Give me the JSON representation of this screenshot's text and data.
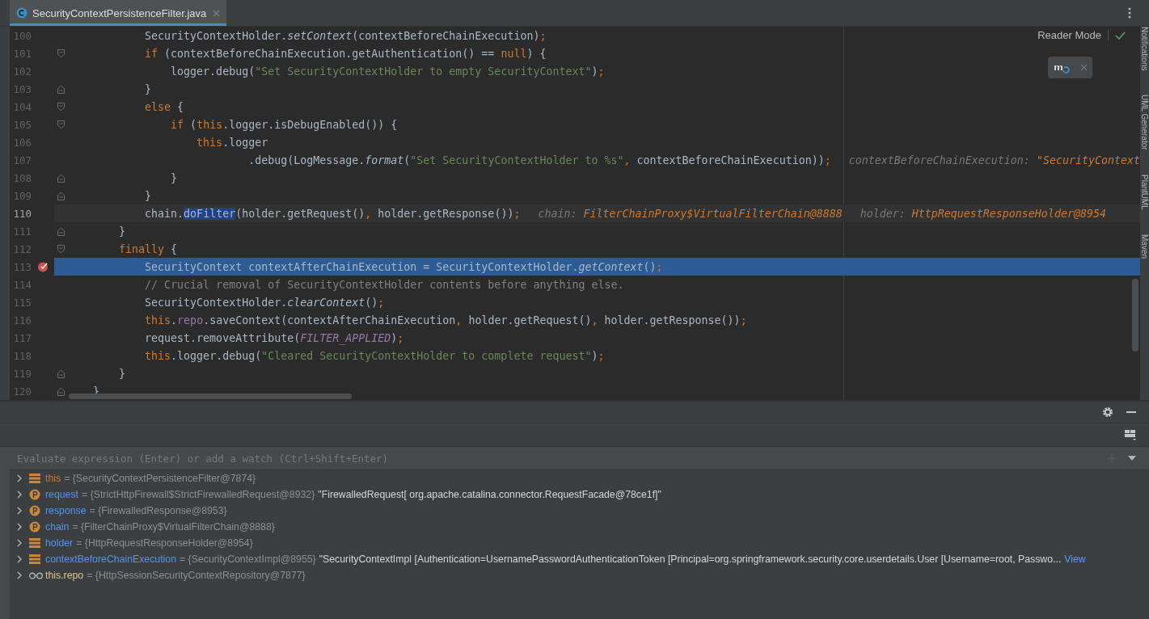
{
  "tab": {
    "title": "SecurityContextPersistenceFilter.java",
    "selected": true
  },
  "reader_mode": "Reader Mode",
  "lines": [
    {
      "number": "100",
      "current": false,
      "caret": false,
      "breakpoint": false,
      "fold_start": false,
      "fold_end": false,
      "code": [
        {
          "kind": "p",
          "t": "            SecurityContextHolder."
        },
        {
          "kind": "i",
          "t": "setContext"
        },
        {
          "kind": "p",
          "t": "(contextBeforeChainExecution)"
        },
        {
          "kind": "o",
          "t": ";"
        }
      ]
    },
    {
      "number": "101",
      "current": false,
      "caret": false,
      "breakpoint": false,
      "fold_start": true,
      "fold_end": false,
      "code": [
        {
          "kind": "o",
          "t": "            if "
        },
        {
          "kind": "p",
          "t": "(contextBeforeChainExecution.getAuthentication() == "
        },
        {
          "kind": "o",
          "t": "null"
        },
        {
          "kind": "p",
          "t": ") {"
        }
      ]
    },
    {
      "number": "102",
      "current": false,
      "caret": false,
      "breakpoint": false,
      "fold_start": false,
      "fold_end": false,
      "code": [
        {
          "kind": "p",
          "t": "                logger.debug("
        },
        {
          "kind": "s",
          "t": "\"Set SecurityContextHolder to empty SecurityContext\""
        },
        {
          "kind": "p",
          "t": ")"
        },
        {
          "kind": "o",
          "t": ";"
        }
      ]
    },
    {
      "number": "103",
      "current": false,
      "caret": false,
      "breakpoint": false,
      "fold_start": false,
      "fold_end": true,
      "code": [
        {
          "kind": "p",
          "t": "            }"
        }
      ]
    },
    {
      "number": "104",
      "current": false,
      "caret": false,
      "breakpoint": false,
      "fold_start": true,
      "fold_end": false,
      "code": [
        {
          "kind": "o",
          "t": "            else "
        },
        {
          "kind": "p",
          "t": "{"
        }
      ]
    },
    {
      "number": "105",
      "current": false,
      "caret": false,
      "breakpoint": false,
      "fold_start": true,
      "fold_end": false,
      "code": [
        {
          "kind": "o",
          "t": "                if "
        },
        {
          "kind": "p",
          "t": "("
        },
        {
          "kind": "o",
          "t": "this"
        },
        {
          "kind": "p",
          "t": ".logger.isDebugEnabled()) {"
        }
      ]
    },
    {
      "number": "106",
      "current": false,
      "caret": false,
      "breakpoint": false,
      "fold_start": false,
      "fold_end": false,
      "code": [
        {
          "kind": "o",
          "t": "                    this"
        },
        {
          "kind": "p",
          "t": ".logger"
        }
      ]
    },
    {
      "number": "107",
      "current": false,
      "caret": false,
      "breakpoint": false,
      "fold_start": false,
      "fold_end": false,
      "code": [
        {
          "kind": "p",
          "t": "                            .debug(LogMessage."
        },
        {
          "kind": "i",
          "t": "format"
        },
        {
          "kind": "p",
          "t": "("
        },
        {
          "kind": "s",
          "t": "\"Set SecurityContextHolder to %s\""
        },
        {
          "kind": "o",
          "t": ", "
        },
        {
          "kind": "p",
          "t": "contextBeforeChainExecution))"
        },
        {
          "kind": "o",
          "t": ";"
        }
      ],
      "hints": [
        {
          "name": "contextBeforeChainExecution:",
          "value": "\"SecurityContext"
        }
      ]
    },
    {
      "number": "108",
      "current": false,
      "caret": false,
      "breakpoint": false,
      "fold_start": false,
      "fold_end": true,
      "code": [
        {
          "kind": "p",
          "t": "                }"
        }
      ]
    },
    {
      "number": "109",
      "current": false,
      "caret": false,
      "breakpoint": false,
      "fold_start": false,
      "fold_end": true,
      "code": [
        {
          "kind": "p",
          "t": "            }"
        }
      ]
    },
    {
      "number": "110",
      "current": false,
      "caret": true,
      "breakpoint": false,
      "fold_start": false,
      "fold_end": false,
      "code": [
        {
          "kind": "p",
          "t": "            chain."
        },
        {
          "kind": "sel",
          "t": "doFilter"
        },
        {
          "kind": "p",
          "t": "(holder.getRequest()"
        },
        {
          "kind": "o",
          "t": ", "
        },
        {
          "kind": "p",
          "t": "holder.getResponse())"
        },
        {
          "kind": "o",
          "t": ";"
        }
      ],
      "hints": [
        {
          "name": "chain:",
          "value": "FilterChainProxy$VirtualFilterChain@8888"
        },
        {
          "name": "holder:",
          "value": "HttpRequestResponseHolder@8954"
        }
      ]
    },
    {
      "number": "111",
      "current": false,
      "caret": false,
      "breakpoint": false,
      "fold_start": false,
      "fold_end": true,
      "code": [
        {
          "kind": "p",
          "t": "        }"
        }
      ]
    },
    {
      "number": "112",
      "current": false,
      "caret": false,
      "breakpoint": false,
      "fold_start": true,
      "fold_end": false,
      "code": [
        {
          "kind": "o",
          "t": "        finally "
        },
        {
          "kind": "p",
          "t": "{"
        }
      ]
    },
    {
      "number": "113",
      "current": true,
      "caret": false,
      "breakpoint": true,
      "fold_start": false,
      "fold_end": false,
      "code": [
        {
          "kind": "p",
          "t": "            SecurityContext contextAfterChainExecution = SecurityContextHolder."
        },
        {
          "kind": "i",
          "t": "getContext"
        },
        {
          "kind": "p",
          "t": "()"
        },
        {
          "kind": "o",
          "t": ";"
        }
      ]
    },
    {
      "number": "114",
      "current": false,
      "caret": false,
      "breakpoint": false,
      "fold_start": false,
      "fold_end": false,
      "code": [
        {
          "kind": "c",
          "t": "            // Crucial removal of SecurityContextHolder contents before anything else."
        }
      ]
    },
    {
      "number": "115",
      "current": false,
      "caret": false,
      "breakpoint": false,
      "fold_start": false,
      "fold_end": false,
      "code": [
        {
          "kind": "p",
          "t": "            SecurityContextHolder."
        },
        {
          "kind": "i",
          "t": "clearContext"
        },
        {
          "kind": "p",
          "t": "()"
        },
        {
          "kind": "o",
          "t": ";"
        }
      ]
    },
    {
      "number": "116",
      "current": false,
      "caret": false,
      "breakpoint": false,
      "fold_start": false,
      "fold_end": false,
      "code": [
        {
          "kind": "o",
          "t": "            this"
        },
        {
          "kind": "p",
          "t": "."
        },
        {
          "kind": "f",
          "t": "repo"
        },
        {
          "kind": "p",
          "t": ".saveContext(contextAfterChainExecution"
        },
        {
          "kind": "o",
          "t": ", "
        },
        {
          "kind": "p",
          "t": "holder.getRequest()"
        },
        {
          "kind": "o",
          "t": ", "
        },
        {
          "kind": "p",
          "t": "holder.getResponse())"
        },
        {
          "kind": "o",
          "t": ";"
        }
      ]
    },
    {
      "number": "117",
      "current": false,
      "caret": false,
      "breakpoint": false,
      "fold_start": false,
      "fold_end": false,
      "code": [
        {
          "kind": "p",
          "t": "            request.removeAttribute("
        },
        {
          "kind": "ic",
          "t": "FILTER_APPLIED"
        },
        {
          "kind": "p",
          "t": ")"
        },
        {
          "kind": "o",
          "t": ";"
        }
      ]
    },
    {
      "number": "118",
      "current": false,
      "caret": false,
      "breakpoint": false,
      "fold_start": false,
      "fold_end": false,
      "code": [
        {
          "kind": "o",
          "t": "            this"
        },
        {
          "kind": "p",
          "t": ".logger.debug("
        },
        {
          "kind": "s",
          "t": "\"Cleared SecurityContextHolder to complete request\""
        },
        {
          "kind": "p",
          "t": ")"
        },
        {
          "kind": "o",
          "t": ";"
        }
      ]
    },
    {
      "number": "119",
      "current": false,
      "caret": false,
      "breakpoint": false,
      "fold_start": false,
      "fold_end": true,
      "code": [
        {
          "kind": "p",
          "t": "        }"
        }
      ]
    },
    {
      "number": "120",
      "current": false,
      "caret": false,
      "breakpoint": false,
      "fold_start": false,
      "fold_end": true,
      "code": [
        {
          "kind": "p",
          "t": "    }"
        }
      ]
    }
  ],
  "side_tools": [
    "Notifications",
    "UML Generator",
    "PlantUML",
    "Maven"
  ],
  "evaluate": {
    "placeholder": "Evaluate expression (Enter) or add a watch (Ctrl+Shift+Enter)"
  },
  "variables": [
    {
      "kind": "field",
      "name": "this",
      "color": "#cc7832",
      "expanded": false,
      "type": "= {SecurityContextPersistenceFilter@7874}"
    },
    {
      "kind": "param",
      "name": "request",
      "color": "#5394ec",
      "expanded": false,
      "type": "= {StrictHttpFirewall$StrictFirewalledRequest@8932}",
      "value": "\"FirewalledRequest[ org.apache.catalina.connector.RequestFacade@78ce1f]\""
    },
    {
      "kind": "param",
      "name": "response",
      "color": "#5394ec",
      "expanded": false,
      "type": "= {FirewalledResponse@8953}"
    },
    {
      "kind": "param",
      "name": "chain",
      "color": "#5394ec",
      "expanded": false,
      "type": "= {FilterChainProxy$VirtualFilterChain@8888}"
    },
    {
      "kind": "field",
      "name": "holder",
      "color": "#5394ec",
      "expanded": false,
      "type": "= {HttpRequestResponseHolder@8954}"
    },
    {
      "kind": "field",
      "name": "contextBeforeChainExecution",
      "color": "#5394ec",
      "expanded": false,
      "type": "= {SecurityContextImpl@8955}",
      "value": "\"SecurityContextImpl [Authentication=UsernamePasswordAuthenticationToken [Principal=org.springframework.security.core.userdetails.User [Username=root, Passwo...",
      "link": "View"
    },
    {
      "kind": "watch",
      "name": "this.repo",
      "color": "#d8c690",
      "expanded": false,
      "type": "= {HttpSessionSecurityContextRepository@7877}"
    }
  ]
}
